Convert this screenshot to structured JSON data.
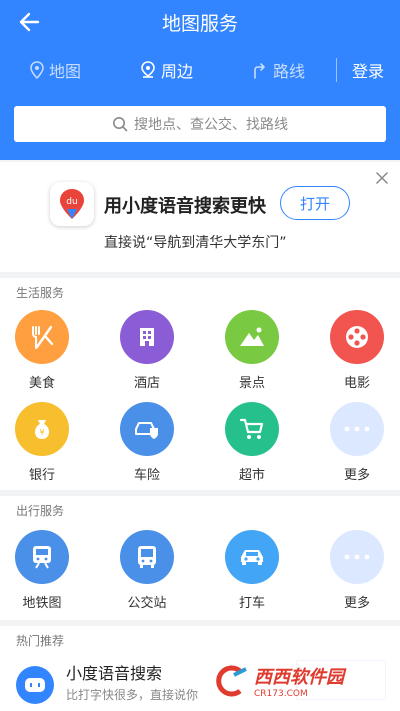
{
  "header": {
    "title": "地图服务",
    "tabs": [
      {
        "label": "地图",
        "icon": "location-pin-icon"
      },
      {
        "label": "周边",
        "icon": "nearby-pin-icon"
      },
      {
        "label": "路线",
        "icon": "route-icon"
      }
    ],
    "active_tab": "周边",
    "login_label": "登录",
    "accent_color": "#3385ff"
  },
  "search": {
    "placeholder": "搜地点、查公交、找路线"
  },
  "promo": {
    "logo_text": "du",
    "title": "用小度语音搜索更快",
    "button": "打开",
    "subtitle": "直接说“导航到清华大学东门”"
  },
  "life_services": {
    "title": "生活服务",
    "items": [
      {
        "label": "美食",
        "icon": "food-icon",
        "color": "#ff9f40"
      },
      {
        "label": "酒店",
        "icon": "hotel-icon",
        "color": "#8a5cd6"
      },
      {
        "label": "景点",
        "icon": "scenery-icon",
        "color": "#7ac943"
      },
      {
        "label": "电影",
        "icon": "film-icon",
        "color": "#f2554f"
      },
      {
        "label": "银行",
        "icon": "bank-icon",
        "color": "#f7bf2d"
      },
      {
        "label": "车险",
        "icon": "car-insurance-icon",
        "color": "#4a90e8"
      },
      {
        "label": "超市",
        "icon": "supermarket-icon",
        "color": "#26c08d"
      },
      {
        "label": "更多",
        "icon": "more-icon",
        "color": "#dbe8ff"
      }
    ]
  },
  "travel_services": {
    "title": "出行服务",
    "items": [
      {
        "label": "地铁图",
        "icon": "subway-icon",
        "color": "#4a90e8"
      },
      {
        "label": "公交站",
        "icon": "bus-icon",
        "color": "#4a90e8"
      },
      {
        "label": "打车",
        "icon": "taxi-icon",
        "color": "#42a5f5"
      },
      {
        "label": "更多",
        "icon": "more-icon",
        "color": "#dbe8ff"
      }
    ]
  },
  "hot": {
    "title": "热门推荐",
    "item_title": "小度语音搜索",
    "item_sub": "比打字快很多，直接说你"
  },
  "watermark": {
    "main": "西西软件园",
    "url": "CR173.COM"
  }
}
